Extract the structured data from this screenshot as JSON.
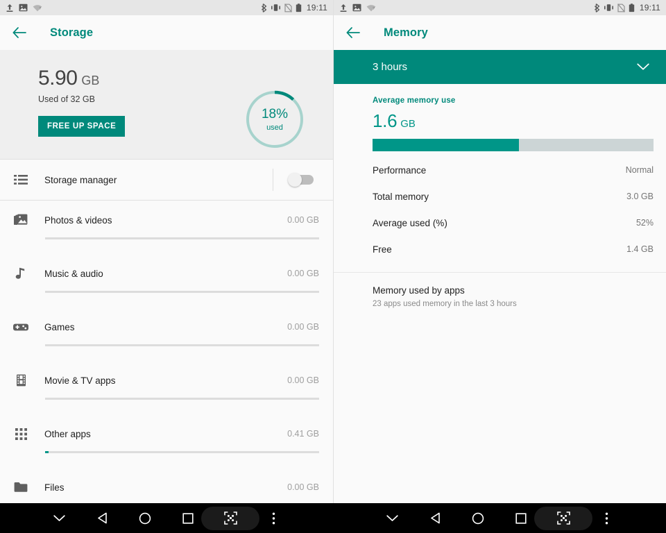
{
  "status_bar": {
    "icons_left": [
      "upload-icon",
      "screenshot-icon",
      "wifi-unknown-icon"
    ],
    "icons_right": [
      "bluetooth-icon",
      "vibrate-icon",
      "sim-off-icon",
      "battery-icon"
    ],
    "time": "19:11"
  },
  "colors": {
    "accent": "#00897b",
    "accent_bright": "#009688",
    "bar_track": "#ccd5d6",
    "nav_background": "#000000",
    "summary_background": "#efefef"
  },
  "storage": {
    "title": "Storage",
    "back_icon": "back-arrow-icon",
    "summary": {
      "used_value": "5.90",
      "used_unit": "GB",
      "subtitle": "Used of 32 GB",
      "free_up_button": "FREE UP SPACE",
      "donut_percent_label": "18%",
      "donut_sub_label": "used",
      "donut_percent_value": 18
    },
    "manager": {
      "icon": "list-icon",
      "label": "Storage manager",
      "toggle_state": "off"
    },
    "categories": [
      {
        "icon": "photo-icon",
        "label": "Photos & videos",
        "size": "0.00 GB",
        "fill_percent": 0
      },
      {
        "icon": "music-note-icon",
        "label": "Music & audio",
        "size": "0.00 GB",
        "fill_percent": 0
      },
      {
        "icon": "gamepad-icon",
        "label": "Games",
        "size": "0.00 GB",
        "fill_percent": 0
      },
      {
        "icon": "film-icon",
        "label": "Movie & TV apps",
        "size": "0.00 GB",
        "fill_percent": 0
      },
      {
        "icon": "apps-grid-icon",
        "label": "Other apps",
        "size": "0.41 GB",
        "fill_percent": 1.3
      },
      {
        "icon": "folder-icon",
        "label": "Files",
        "size": "0.00 GB",
        "fill_percent": 0
      }
    ]
  },
  "memory": {
    "title": "Memory",
    "back_icon": "back-arrow-icon",
    "period": {
      "label": "3 hours",
      "chevron_icon": "chevron-down-icon"
    },
    "average_heading": "Average memory use",
    "average_value": "1.6",
    "average_unit": "GB",
    "usage_bar_percent": 52,
    "stats": [
      {
        "key": "Performance",
        "value": "Normal"
      },
      {
        "key": "Total memory",
        "value": "3.0 GB"
      },
      {
        "key": "Average used (%)",
        "value": "52%"
      },
      {
        "key": "Free",
        "value": "1.4 GB"
      }
    ],
    "apps_section": {
      "title": "Memory used by apps",
      "subtitle": "23 apps used memory in the last 3 hours"
    }
  },
  "nav_bar": {
    "buttons": [
      "chevron-down-icon",
      "back-triangle-icon",
      "home-circle-icon",
      "recents-square-icon",
      "screenshot-capture-icon",
      "overflow-menu-icon"
    ]
  }
}
